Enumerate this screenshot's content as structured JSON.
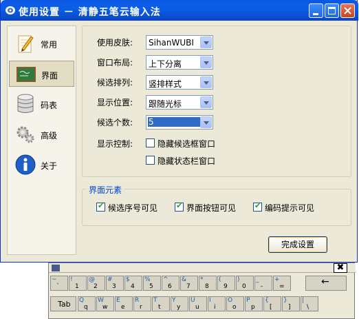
{
  "window": {
    "title": "使用设置 － 清静五笔云输入法"
  },
  "nav": [
    {
      "label": "常用",
      "icon": "pen-paper-icon"
    },
    {
      "label": "界面",
      "icon": "chalkboard-icon"
    },
    {
      "label": "码表",
      "icon": "database-icon"
    },
    {
      "label": "高级",
      "icon": "gears-icon"
    },
    {
      "label": "关于",
      "icon": "info-icon"
    }
  ],
  "settings": {
    "skin_label": "使用皮肤:",
    "skin_value": "SihanWUBI",
    "layout_label": "窗口布局:",
    "layout_value": "上下分离",
    "arrange_label": "候选排列:",
    "arrange_value": "竖排样式",
    "position_label": "显示位置:",
    "position_value": "跟随光标",
    "count_label": "候选个数:",
    "count_value": "5",
    "control_label": "显示控制:",
    "hide_candidate": "隐藏候选框窗口",
    "hide_status": "隐藏状态栏窗口"
  },
  "elements": {
    "title": "界面元素",
    "show_serial": "候选序号可见",
    "show_buttons": "界面按钮可见",
    "show_hint": "编码提示可见"
  },
  "ok_button": "完成设置",
  "keyboard": {
    "close": "✖",
    "row1": [
      {
        "t": "~",
        "b": "`"
      },
      {
        "t": "!",
        "b": "1"
      },
      {
        "t": "@",
        "b": "2"
      },
      {
        "t": "#",
        "b": "3"
      },
      {
        "t": "$",
        "b": "4"
      },
      {
        "t": "%",
        "b": "5"
      },
      {
        "t": "^",
        "b": "6"
      },
      {
        "t": "&",
        "b": "7"
      },
      {
        "t": "*",
        "b": "8"
      },
      {
        "t": "(",
        "b": "9"
      },
      {
        "t": ")",
        "b": "0"
      },
      {
        "t": "_",
        "b": "-"
      },
      {
        "t": "+",
        "b": "="
      }
    ],
    "backspace": "←",
    "tab": "Tab",
    "row2": [
      {
        "t": "Q",
        "b": "q"
      },
      {
        "t": "W",
        "b": "w"
      },
      {
        "t": "E",
        "b": "e"
      },
      {
        "t": "R",
        "b": "r"
      },
      {
        "t": "T",
        "b": "t"
      },
      {
        "t": "Y",
        "b": "y"
      },
      {
        "t": "U",
        "b": "u"
      },
      {
        "t": "I",
        "b": "i"
      },
      {
        "t": "O",
        "b": "o"
      },
      {
        "t": "P",
        "b": "p"
      },
      {
        "t": "{",
        "b": "["
      },
      {
        "t": "}",
        "b": "]"
      },
      {
        "t": "|",
        "b": "\\"
      }
    ]
  }
}
